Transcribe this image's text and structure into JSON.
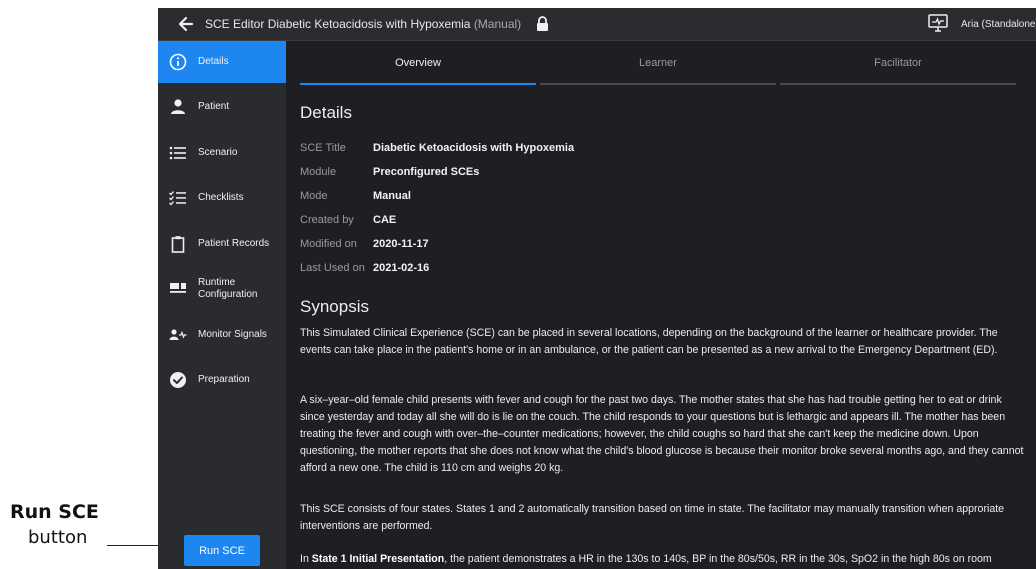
{
  "callout": {
    "title": "Run SCE",
    "subtitle": "button"
  },
  "topbar": {
    "prefix": "SCE Editor",
    "title": "Diabetic Ketoacidosis with Hypoxemia",
    "mode": "(Manual)",
    "user": "Aria (Standalone)"
  },
  "sidebar": {
    "items": [
      {
        "label": "Details",
        "icon": "info-icon"
      },
      {
        "label": "Patient",
        "icon": "person-icon"
      },
      {
        "label": "Scenario",
        "icon": "list-icon"
      },
      {
        "label": "Checklists",
        "icon": "checklist-icon"
      },
      {
        "label": "Patient Records",
        "icon": "clipboard-icon"
      },
      {
        "label": "Runtime Configuration",
        "icon": "configuration-icon"
      },
      {
        "label": "Monitor Signals",
        "icon": "person-signal-icon"
      },
      {
        "label": "Preparation",
        "icon": "check-circle-icon"
      }
    ],
    "run_button": "Run SCE"
  },
  "tabs": [
    "Overview",
    "Learner",
    "Facilitator"
  ],
  "details": {
    "heading": "Details",
    "rows": [
      {
        "key": "SCE Title",
        "value": "Diabetic Ketoacidosis with Hypoxemia"
      },
      {
        "key": "Module",
        "value": "Preconfigured SCEs"
      },
      {
        "key": "Mode",
        "value": "Manual"
      },
      {
        "key": "Created by",
        "value": "CAE"
      },
      {
        "key": "Modified on",
        "value": "2020-11-17"
      },
      {
        "key": "Last Used on",
        "value": "2021-02-16"
      }
    ]
  },
  "synopsis": {
    "heading": "Synopsis",
    "p1": "This Simulated Clinical Experience (SCE) can be placed in several locations, depending on the background of the learner or healthcare provider. The events can take place in the patient's home or in an ambulance, or the patient can be presented as a new arrival to the Emergency Department (ED).",
    "p2": "A six–year–old female child presents with fever and cough for the past two days. The mother states that she has had trouble getting her to eat or drink since yesterday and today all she will do is lie on the couch. The child responds to your questions but is lethargic and appears ill. The mother has been treating the fever and cough with over–the–counter medications; however, the child coughs so hard that she can't keep the medicine down. Upon questioning, the mother reports that she does not know what the child's blood glucose is because their monitor broke several months ago, and they cannot afford a new one. The child is 110 cm and weighs 20 kg.",
    "p3": "This SCE consists of four states. States 1 and 2 automatically transition based on time in state. The facilitator may manually transition when approriate interventions are performed.",
    "p4_prefix": "In ",
    "p4_bold": "State 1 Initial Presentation",
    "p4_rest": ", the patient demonstrates a HR in the 130s to 140s, BP in the 80s/50s, RR in the 30s, SpO2 in the high 80s on room"
  },
  "colors": {
    "accent": "#1d86f0",
    "sidebar": "#2a2b2f",
    "background": "#1e1f22"
  }
}
